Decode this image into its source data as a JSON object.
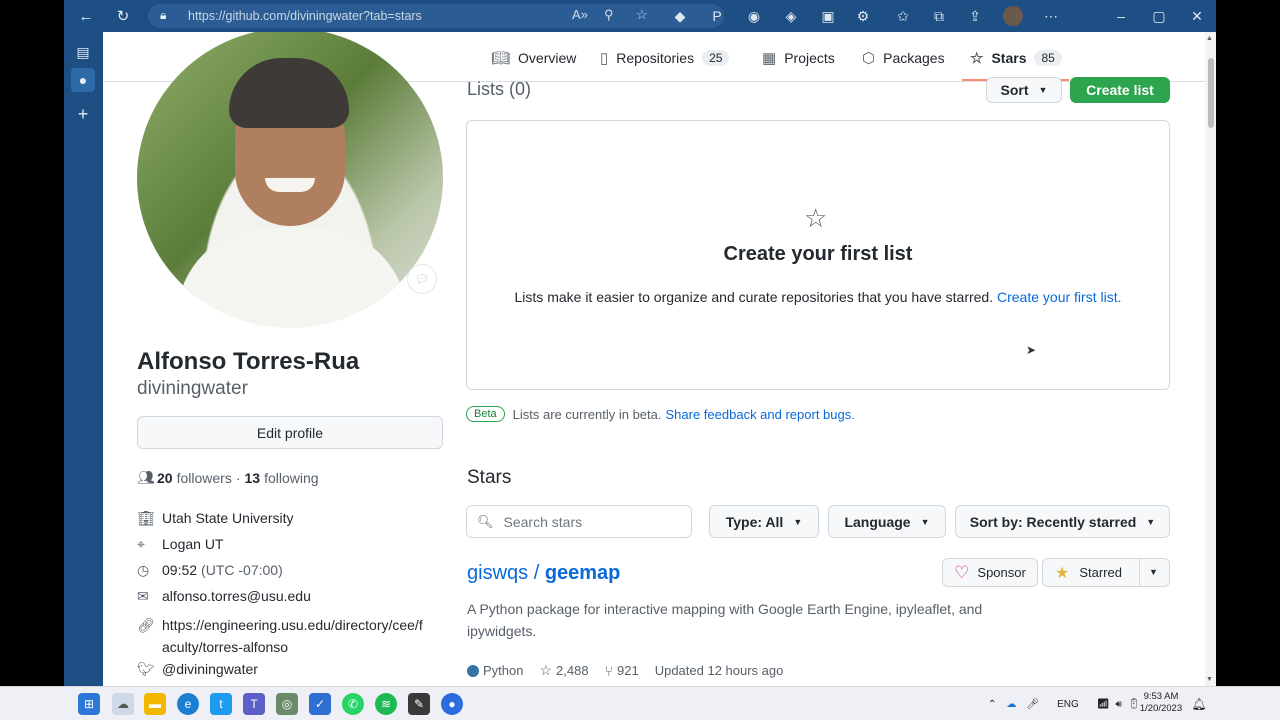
{
  "browser": {
    "url": "https://github.com/diviningwater?tab=stars"
  },
  "tabs": [
    {
      "label": "Overview",
      "icon": "book-icon"
    },
    {
      "label": "Repositories",
      "icon": "repo-icon",
      "count": "25"
    },
    {
      "label": "Projects",
      "icon": "table-icon"
    },
    {
      "label": "Packages",
      "icon": "package-icon"
    },
    {
      "label": "Stars",
      "icon": "star-icon",
      "count": "85"
    }
  ],
  "profile": {
    "fullname": "Alfonso Torres-Rua",
    "login": "diviningwater",
    "edit_label": "Edit profile",
    "followers_count": "20",
    "followers_label": "followers",
    "separator": "·",
    "following_count": "13",
    "following_label": "following",
    "organization": "Utah State University",
    "location": "Logan UT",
    "time": "09:52",
    "timezone": "(UTC -07:00)",
    "email": "alfonso.torres@usu.edu",
    "website_line1": "https://engineering.usu.edu/directory/cee/f",
    "website_line2": "aculty/torres-alfonso",
    "twitter": "@diviningwater"
  },
  "lists": {
    "title": "Lists (0)",
    "sort_label": "Sort",
    "create_label": "Create list",
    "empty_title": "Create your first list",
    "empty_desc": "Lists make it easier to organize and curate repositories that you have starred.",
    "empty_link": "Create your first list.",
    "beta_badge": "Beta",
    "beta_text": "Lists are currently in beta.",
    "beta_link": "Share feedback and report bugs."
  },
  "stars": {
    "title": "Stars",
    "search_placeholder": "Search stars",
    "type_filter": "Type: All",
    "language_filter": "Language",
    "sort_filter": "Sort by: Recently starred"
  },
  "repo": {
    "owner": "giswqs",
    "slash": " / ",
    "name": "geemap",
    "description": "A Python package for interactive mapping with Google Earth Engine, ipyleaflet, and ipywidgets.",
    "sponsor_label": "Sponsor",
    "starred_label": "Starred",
    "language": "Python",
    "language_color": "#3572A5",
    "stars": "2,488",
    "forks": "921",
    "updated": "Updated 12 hours ago"
  },
  "taskbar": {
    "lang": "ENG",
    "time": "9:53 AM",
    "date": "1/20/2023"
  },
  "colors": {
    "browser_chrome": "#1d4f85",
    "primary_green": "#2da44e",
    "link_blue": "#0969da",
    "tab_underline": "#fd8c73"
  }
}
